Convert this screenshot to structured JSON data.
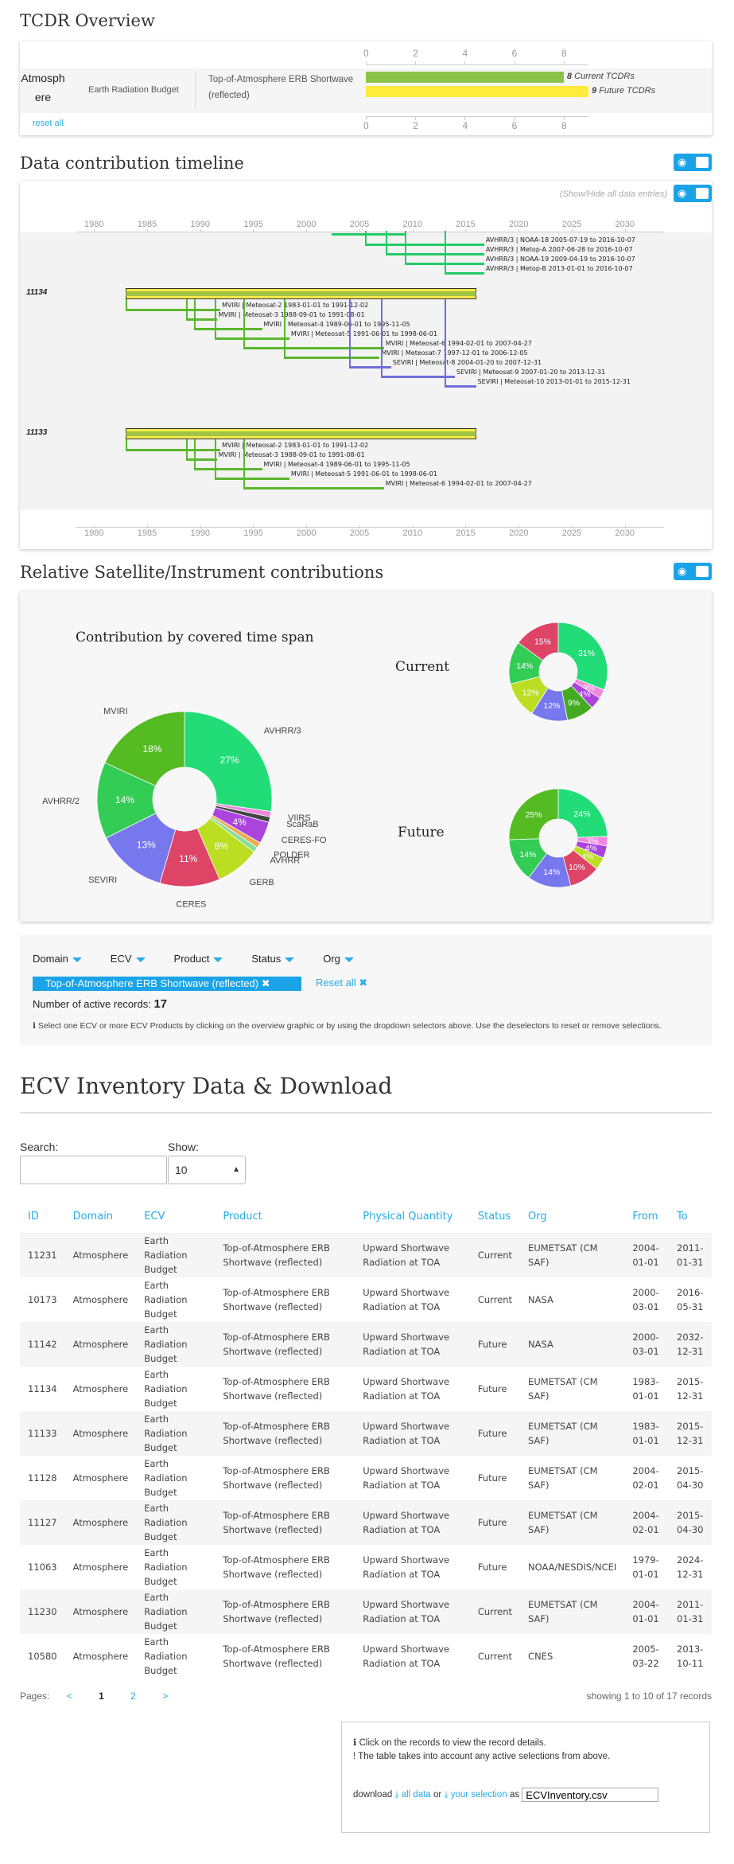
{
  "overview": {
    "title": "TCDR Overview",
    "domain": "Atmosphere",
    "ecv": "Earth Radiation Budget",
    "product": "Top-of-Atmosphere ERB Shortwave (reflected)",
    "axis": [
      "0",
      "2",
      "4",
      "6",
      "8"
    ],
    "current_count": "8",
    "current_label": "Current TCDRs",
    "future_count": "9",
    "future_label": "Future TCDRs",
    "current_value": 8,
    "future_value": 9,
    "axis_max": 9,
    "reset_all": "reset all"
  },
  "timeline": {
    "title": "Data contribution timeline",
    "show_hide": "(Show/Hide all data entries)",
    "years": [
      "1980",
      "1985",
      "1990",
      "1995",
      "2000",
      "2005",
      "2010",
      "2015",
      "2020",
      "2025",
      "2030"
    ],
    "groups": [
      {
        "id": "",
        "entries": [
          {
            "inst": "AVHRR/3",
            "sat": "NOAA-18",
            "start": "2005-07-19",
            "end": "2016-10-07",
            "color": "#22cc66"
          },
          {
            "inst": "AVHRR/3",
            "sat": "Metop-A",
            "start": "2007-06-28",
            "end": "2016-10-07",
            "color": "#22cc66"
          },
          {
            "inst": "AVHRR/3",
            "sat": "NOAA-19",
            "start": "2009-04-19",
            "end": "2016-10-07",
            "color": "#22cc66"
          },
          {
            "inst": "AVHRR/3",
            "sat": "Metop-B",
            "start": "2013-01-01",
            "end": "2016-10-07",
            "color": "#22cc66"
          }
        ]
      },
      {
        "id": "11134",
        "entries": [
          {
            "inst": "MVIRI",
            "sat": "Meteosat-2",
            "start": "1983-01-01",
            "end": "1991-12-02",
            "color": "#5ab82d"
          },
          {
            "inst": "MVIRI",
            "sat": "Meteosat-3",
            "start": "1988-09-01",
            "end": "1991-08-01",
            "color": "#5ab82d"
          },
          {
            "inst": "MVIRI",
            "sat": "Meteosat-4",
            "start": "1989-06-01",
            "end": "1995-11-05",
            "color": "#5ab82d"
          },
          {
            "inst": "MVIRI",
            "sat": "Meteosat-5",
            "start": "1991-06-01",
            "end": "1998-06-01",
            "color": "#5ab82d"
          },
          {
            "inst": "MVIRI",
            "sat": "Meteosat-6",
            "start": "1994-02-01",
            "end": "2007-04-27",
            "color": "#5ab82d"
          },
          {
            "inst": "MVIRI",
            "sat": "Meteosat-7",
            "start": "1997-12-01",
            "end": "2006-12-05",
            "color": "#5ab82d"
          },
          {
            "inst": "SEVIRI",
            "sat": "Meteosat-8",
            "start": "2004-01-20",
            "end": "2007-12-31",
            "color": "#6f6fdc"
          },
          {
            "inst": "SEVIRI",
            "sat": "Meteosat-9",
            "start": "2007-01-20",
            "end": "2013-12-31",
            "color": "#6f6fdc"
          },
          {
            "inst": "SEVIRI",
            "sat": "Meteosat-10",
            "start": "2013-01-01",
            "end": "2015-12-31",
            "color": "#6f6fdc"
          }
        ]
      },
      {
        "id": "11133",
        "entries": [
          {
            "inst": "MVIRI",
            "sat": "Meteosat-2",
            "start": "1983-01-01",
            "end": "1991-12-02",
            "color": "#5ab82d"
          },
          {
            "inst": "MVIRI",
            "sat": "Meteosat-3",
            "start": "1988-09-01",
            "end": "1991-08-01",
            "color": "#5ab82d"
          },
          {
            "inst": "MVIRI",
            "sat": "Meteosat-4",
            "start": "1989-06-01",
            "end": "1995-11-05",
            "color": "#5ab82d"
          },
          {
            "inst": "MVIRI",
            "sat": "Meteosat-5",
            "start": "1991-06-01",
            "end": "1998-06-01",
            "color": "#5ab82d"
          },
          {
            "inst": "MVIRI",
            "sat": "Meteosat-6",
            "start": "1994-02-01",
            "end": "2007-04-27",
            "color": "#5ab82d"
          }
        ]
      }
    ]
  },
  "relative": {
    "title": "Relative Satellite/Instrument contributions",
    "pie_title": "Contribution by covered time span",
    "current_label": "Current",
    "future_label": "Future"
  },
  "chart_data": [
    {
      "type": "pie",
      "title": "Contribution by covered time span",
      "categories": [
        "AVHRR/3",
        "VIIRS",
        "ScaRaB",
        "CERES-FO",
        "POLDER",
        "AVHRR",
        "GERB",
        "CERES",
        "SEVIRI",
        "AVHRR/2",
        "MVIRI"
      ],
      "values": [
        27,
        1,
        1,
        4,
        1,
        1,
        8,
        11,
        13,
        14,
        18
      ],
      "colors": [
        "#22dd77",
        "#ee88dd",
        "#444444",
        "#aa44dd",
        "#eeaa55",
        "#88dd99",
        "#bbdd22",
        "#dd4466",
        "#7777ee",
        "#33cc55",
        "#55bb22"
      ]
    },
    {
      "type": "pie",
      "title": "Current",
      "values": [
        31,
        3,
        4,
        9,
        12,
        12,
        14,
        15
      ],
      "colors": [
        "#22dd77",
        "#ee88dd",
        "#aa44dd",
        "#44aa22",
        "#7777ee",
        "#bbdd22",
        "#33cc55",
        "#dd4466"
      ]
    },
    {
      "type": "pie",
      "title": "Future",
      "values": [
        24,
        3,
        4,
        4,
        10,
        14,
        14,
        25
      ],
      "colors": [
        "#22dd77",
        "#ee88dd",
        "#aa44dd",
        "#bbdd22",
        "#dd4466",
        "#7777ee",
        "#33cc55",
        "#55bb22"
      ]
    }
  ],
  "filters": {
    "menus": [
      "Domain",
      "ECV",
      "Product",
      "Status",
      "Org"
    ],
    "tag": "Top-of-Atmosphere ERB Shortwave (reflected)",
    "reset": "Reset all",
    "active_label": "Number of active records:",
    "active_count": "17",
    "hint": "Select one ECV or more ECV Products by clicking on the overview graphic or by using the dropdown selectors above. Use the deselectors to reset or remove selections."
  },
  "inventory": {
    "title": "ECV Inventory Data & Download",
    "search_label": "Search:",
    "search_value": "",
    "show_label": "Show:",
    "show_value": "10",
    "columns": [
      "ID",
      "Domain",
      "ECV",
      "Product",
      "Physical Quantity",
      "Status",
      "Org",
      "From",
      "To"
    ],
    "rows": [
      [
        "11231",
        "Atmosphere",
        "Earth Radiation Budget",
        "Top-of-Atmosphere ERB Shortwave (reflected)",
        "Upward Shortwave Radiation at TOA",
        "Current",
        "EUMETSAT (CM SAF)",
        "2004-01-01",
        "2011-01-31"
      ],
      [
        "10173",
        "Atmosphere",
        "Earth Radiation Budget",
        "Top-of-Atmosphere ERB Shortwave (reflected)",
        "Upward Shortwave Radiation at TOA",
        "Current",
        "NASA",
        "2000-03-01",
        "2016-05-31"
      ],
      [
        "11142",
        "Atmosphere",
        "Earth Radiation Budget",
        "Top-of-Atmosphere ERB Shortwave (reflected)",
        "Upward Shortwave Radiation at TOA",
        "Future",
        "NASA",
        "2000-03-01",
        "2032-12-31"
      ],
      [
        "11134",
        "Atmosphere",
        "Earth Radiation Budget",
        "Top-of-Atmosphere ERB Shortwave (reflected)",
        "Upward Shortwave Radiation at TOA",
        "Future",
        "EUMETSAT (CM SAF)",
        "1983-01-01",
        "2015-12-31"
      ],
      [
        "11133",
        "Atmosphere",
        "Earth Radiation Budget",
        "Top-of-Atmosphere ERB Shortwave (reflected)",
        "Upward Shortwave Radiation at TOA",
        "Future",
        "EUMETSAT (CM SAF)",
        "1983-01-01",
        "2015-12-31"
      ],
      [
        "11128",
        "Atmosphere",
        "Earth Radiation Budget",
        "Top-of-Atmosphere ERB Shortwave (reflected)",
        "Upward Shortwave Radiation at TOA",
        "Future",
        "EUMETSAT (CM SAF)",
        "2004-02-01",
        "2015-04-30"
      ],
      [
        "11127",
        "Atmosphere",
        "Earth Radiation Budget",
        "Top-of-Atmosphere ERB Shortwave (reflected)",
        "Upward Shortwave Radiation at TOA",
        "Future",
        "EUMETSAT (CM SAF)",
        "2004-02-01",
        "2015-04-30"
      ],
      [
        "11063",
        "Atmosphere",
        "Earth Radiation Budget",
        "Top-of-Atmosphere ERB Shortwave (reflected)",
        "Upward Shortwave Radiation at TOA",
        "Future",
        "NOAA/NESDIS/NCEI",
        "1979-01-01",
        "2024-12-31"
      ],
      [
        "11230",
        "Atmosphere",
        "Earth Radiation Budget",
        "Top-of-Atmosphere ERB Shortwave (reflected)",
        "Upward Shortwave Radiation at TOA",
        "Current",
        "EUMETSAT (CM SAF)",
        "2004-01-01",
        "2011-01-31"
      ],
      [
        "10580",
        "Atmosphere",
        "Earth Radiation Budget",
        "Top-of-Atmosphere ERB Shortwave (reflected)",
        "Upward Shortwave Radiation at TOA",
        "Current",
        "CNES",
        "2005-03-22",
        "2013-10-11"
      ]
    ],
    "pages_label": "Pages:",
    "prev": "<",
    "page1": "1",
    "page2": "2",
    "next": ">",
    "showing": "showing 1 to 10 of 17 records",
    "note1": "Click on the records to view the record details.",
    "note2": "The table takes into account any active selections from above.",
    "download": "download",
    "all_data": "all data",
    "or": "or",
    "your_selection": "your selection",
    "as": "as",
    "filename": "ECVInventory.csv"
  }
}
